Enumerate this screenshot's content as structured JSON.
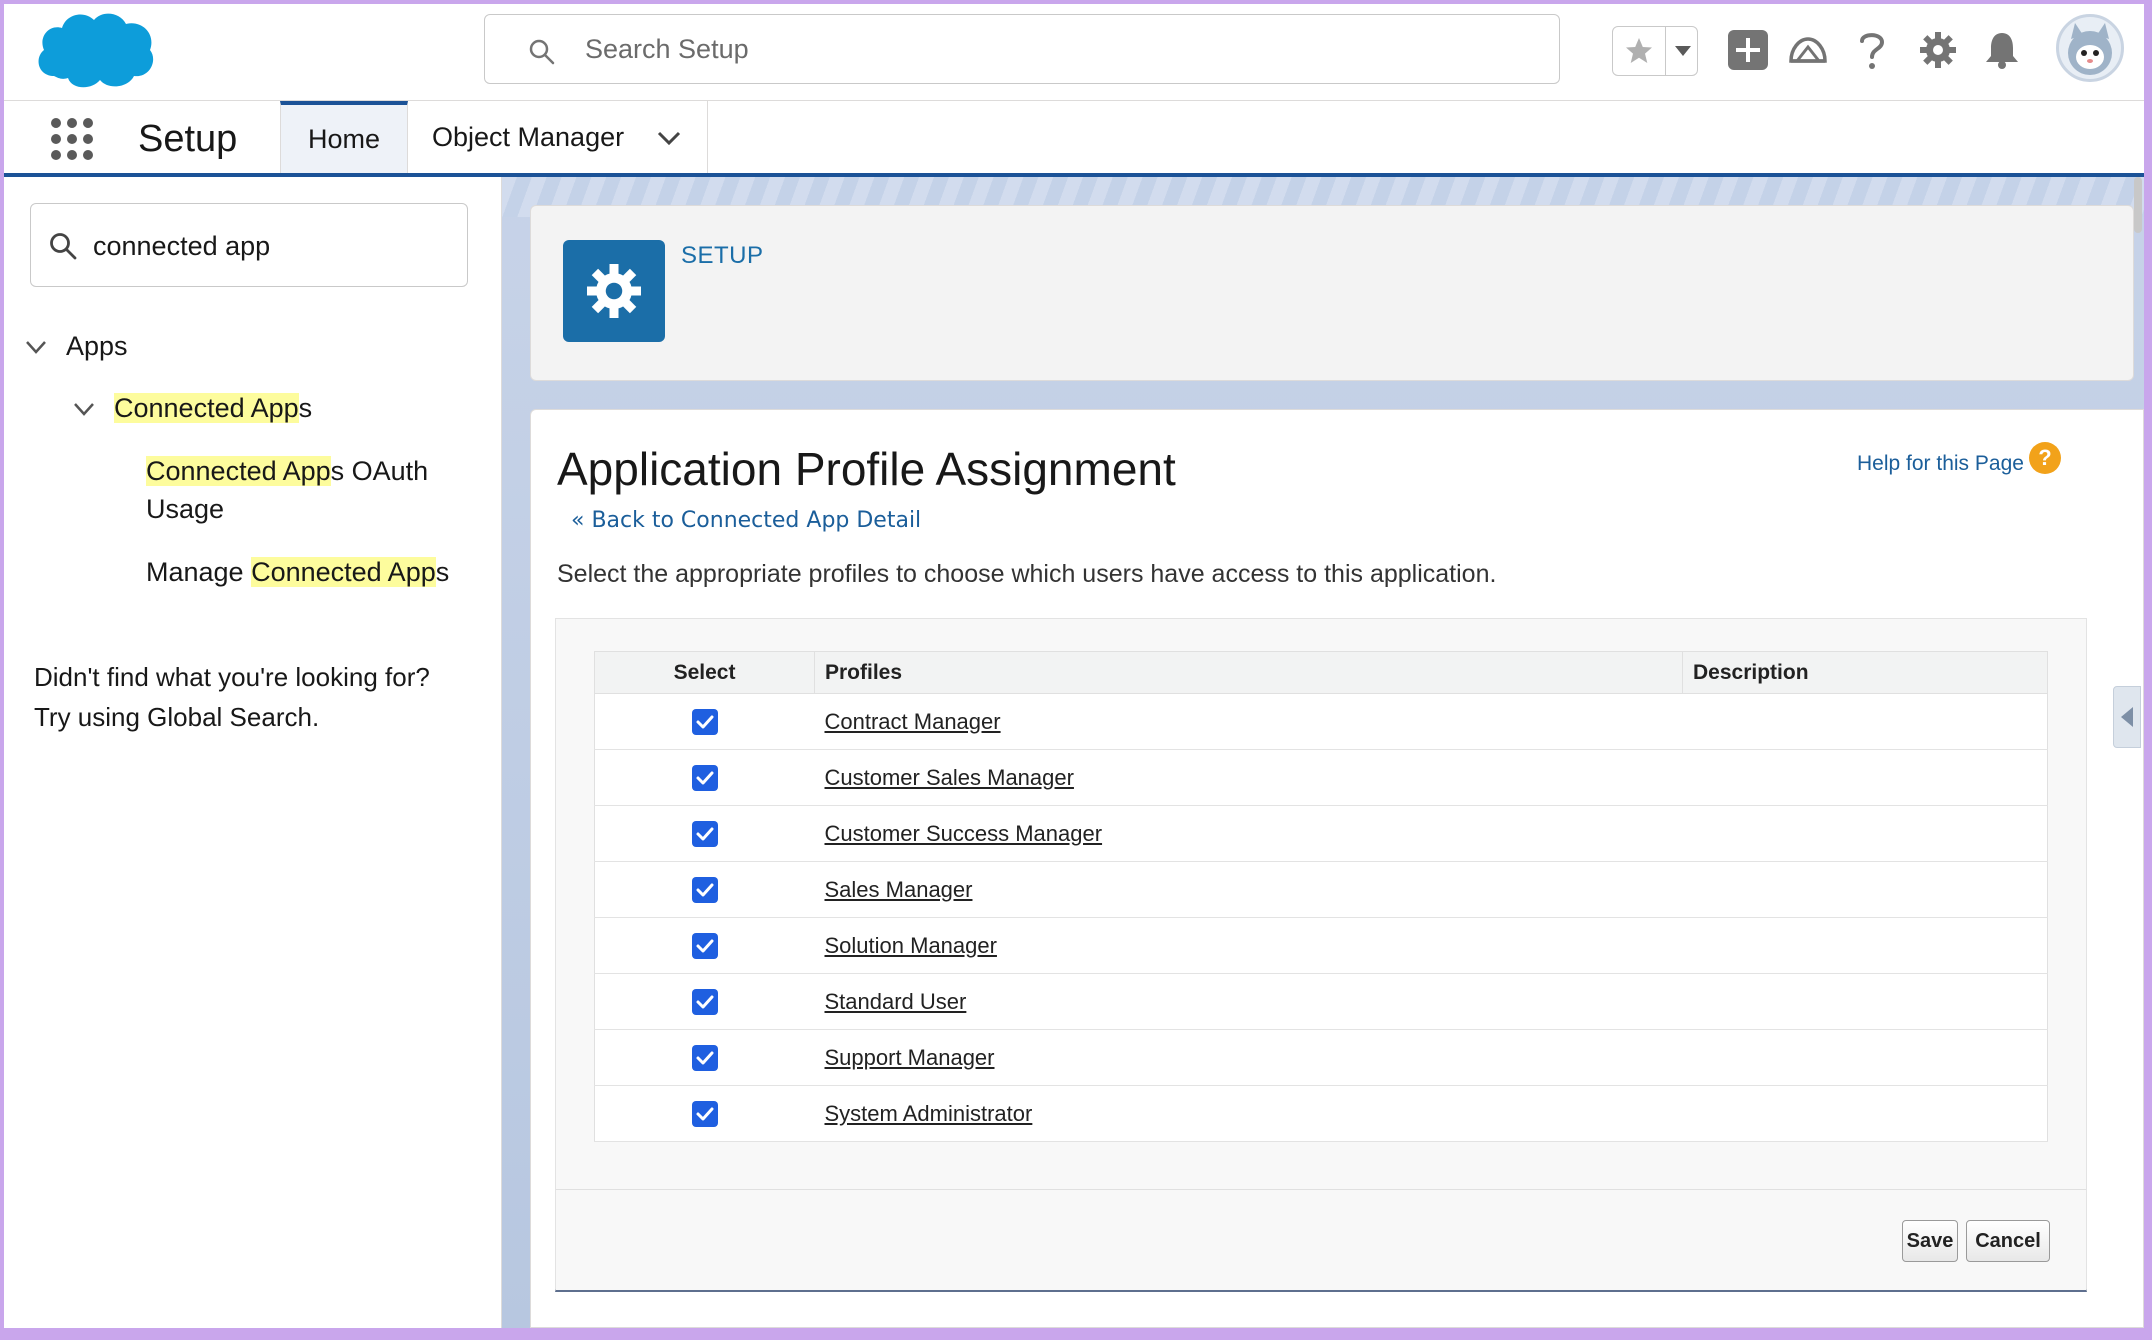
{
  "header": {
    "search_placeholder": "Search Setup"
  },
  "context_bar": {
    "app_name": "Setup",
    "tabs": [
      {
        "label": "Home",
        "active": true
      },
      {
        "label": "Object Manager",
        "active": false
      }
    ]
  },
  "sidebar": {
    "quick_find_value": "connected app",
    "tree": {
      "apps": "Apps",
      "connected_apps": {
        "highlight": "Connected App",
        "rest": "s"
      },
      "oauth_usage": {
        "highlight": "Connected App",
        "rest_line1": "s OAuth",
        "line2": "Usage"
      },
      "manage": {
        "prefix": "Manage ",
        "highlight": "Connected App",
        "rest": "s"
      }
    },
    "no_result_line1": "Didn't find what you're looking for?",
    "no_result_line2": "Try using Global Search."
  },
  "setup_header": {
    "label": "SETUP"
  },
  "page": {
    "title": "Application Profile Assignment",
    "help_link": "Help for this Page",
    "back_link": "« Back to Connected App Detail",
    "instructions": "Select the appropriate profiles to choose which users have access to this application."
  },
  "table": {
    "columns": [
      "Select",
      "Profiles",
      "Description"
    ],
    "rows": [
      {
        "checked": true,
        "profile": "Contract Manager",
        "description": ""
      },
      {
        "checked": true,
        "profile": "Customer Sales Manager",
        "description": ""
      },
      {
        "checked": true,
        "profile": "Customer Success Manager",
        "description": ""
      },
      {
        "checked": true,
        "profile": "Sales Manager",
        "description": ""
      },
      {
        "checked": true,
        "profile": "Solution Manager",
        "description": ""
      },
      {
        "checked": true,
        "profile": "Standard User",
        "description": ""
      },
      {
        "checked": true,
        "profile": "Support Manager",
        "description": ""
      },
      {
        "checked": true,
        "profile": "System Administrator",
        "description": ""
      }
    ]
  },
  "buttons": {
    "save": "Save",
    "cancel": "Cancel"
  },
  "colors": {
    "brand_blue": "#1b5297",
    "link_blue": "#1b5e9a",
    "setup_tile": "#1b6ea8",
    "checkbox_blue": "#1f5fe0",
    "highlight": "#fdfc9d",
    "help_orange": "#f2a21a",
    "outer_border": "#c9a6ec"
  },
  "icons": {
    "logo": "salesforce-cloud-logo",
    "search": "search-icon",
    "favorite": "star-icon",
    "add": "plus-icon",
    "trailhead": "trailhead-icon",
    "help": "question-icon",
    "settings": "gear-icon",
    "notifications": "bell-icon",
    "avatar": "user-avatar",
    "app_launcher": "waffle-icon"
  }
}
